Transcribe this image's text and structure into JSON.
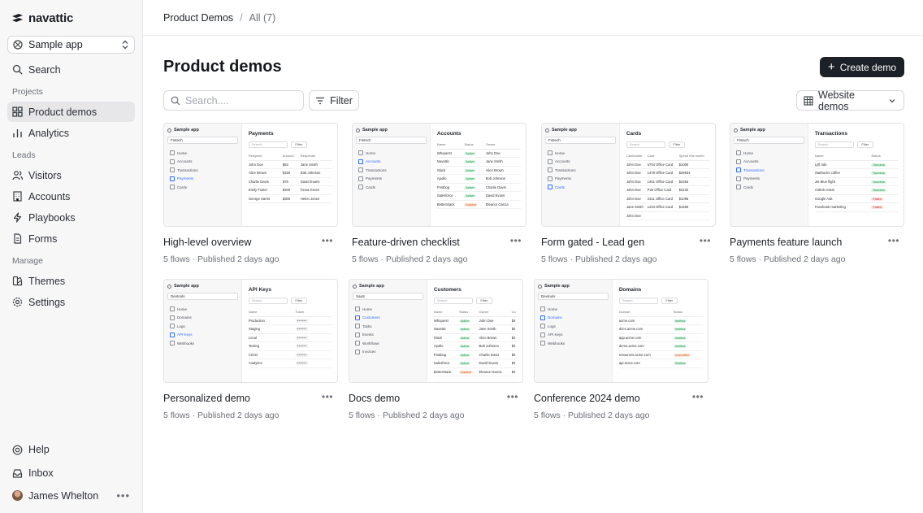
{
  "brand": {
    "name": "navattic"
  },
  "sidebar": {
    "app_select": "Sample app",
    "search": "Search",
    "sections": {
      "projects": "Projects",
      "leads": "Leads",
      "manage": "Manage"
    },
    "projects": [
      {
        "label": "Product demos",
        "icon": "grid-icon",
        "active": true
      },
      {
        "label": "Analytics",
        "icon": "bar-chart-icon",
        "active": false
      }
    ],
    "leads": [
      {
        "label": "Visitors",
        "icon": "users-icon"
      },
      {
        "label": "Accounts",
        "icon": "building-icon"
      },
      {
        "label": "Playbooks",
        "icon": "lightning-icon"
      },
      {
        "label": "Forms",
        "icon": "document-icon"
      }
    ],
    "manage": [
      {
        "label": "Themes",
        "icon": "palette-icon"
      },
      {
        "label": "Settings",
        "icon": "gear-icon"
      }
    ],
    "bottom": {
      "help": "Help",
      "inbox": "Inbox",
      "user": "James Whelton",
      "more": "•••"
    }
  },
  "breadcrumb": {
    "parent": "Product Demos",
    "separator": "/",
    "current": "All (7)"
  },
  "main": {
    "title": "Product demos",
    "create_button": "Create demo",
    "search_placeholder": "Search....",
    "filter_button": "Filter",
    "view_select": "Website demos"
  },
  "demos": [
    {
      "title": "High-level overview",
      "subtitle": "5 flows · Published 2 days ago",
      "more": "•••",
      "thumb": {
        "app": "Sample app",
        "select": "Fintech",
        "nav": [
          "Home",
          "Accounts",
          "Transactions",
          "Payments",
          "Cards"
        ],
        "active_nav": 3,
        "heading": "Payments",
        "search": "Search",
        "filter": "Filter",
        "columns": [
          "Recipient",
          "Amount",
          "Requester"
        ],
        "rows": [
          [
            "John Doe",
            "$53",
            "Jane Smith"
          ],
          [
            "Alice Brown",
            "$150",
            "Bob Johnson"
          ],
          [
            "Charlie Davis",
            "$75",
            "David Evans"
          ],
          [
            "Emily Foster",
            "$200",
            "Fiona Green"
          ],
          [
            "George Harris",
            "$300",
            "Helen Jones"
          ]
        ]
      }
    },
    {
      "title": "Feature-driven checklist",
      "subtitle": "5 flows · Published 2 days ago",
      "more": "•••",
      "thumb": {
        "app": "Sample app",
        "select": "Fintech",
        "nav": [
          "Home",
          "Accounts",
          "Transactions",
          "Payments",
          "Cards"
        ],
        "active_nav": 1,
        "heading": "Accounts",
        "search": "",
        "filter": "",
        "columns": [
          "Name",
          "Status",
          "Owner"
        ],
        "rows": [
          [
            "Whoperst",
            "Active",
            "John Doe"
          ],
          [
            "Navattic",
            "Active",
            "Jane Smith"
          ],
          [
            "Slack",
            "Active",
            "Alice Brown"
          ],
          [
            "Apollo",
            "Active",
            "Bob Johnson"
          ],
          [
            "Postbog",
            "Active",
            "Charlie Davis"
          ],
          [
            "Salesforce",
            "Active",
            "David Evans"
          ],
          [
            "BetterStack",
            "Inactive",
            "Eleanor Garcia"
          ]
        ]
      }
    },
    {
      "title": "Form gated - Lead gen",
      "subtitle": "5 flows · Published 2 days ago",
      "more": "•••",
      "thumb": {
        "app": "Sample app",
        "select": "Fintech",
        "nav": [
          "Home",
          "Accounts",
          "Transactions",
          "Payments",
          "Cards"
        ],
        "active_nav": 4,
        "heading": "Cards",
        "search": "Search",
        "filter": "Filter",
        "columns": [
          "Cardholder",
          "Card",
          "Spend this month"
        ],
        "rows": [
          [
            "John Doe",
            "5704 Office Card",
            "$1000"
          ],
          [
            "John Doe",
            "1478 Office Card",
            "$28634"
          ],
          [
            "John Doe",
            "1401 Office Card",
            "$2353"
          ],
          [
            "John Doe",
            "P25 Office Card",
            "$2232"
          ],
          [
            "John Doe",
            "2411 Office Card",
            "$1096"
          ],
          [
            "Jane Smith",
            "1234 Office Card",
            "$1560"
          ],
          [
            "John Doe",
            "",
            ""
          ]
        ]
      }
    },
    {
      "title": "Payments feature launch",
      "subtitle": "5 flows · Published 2 days ago",
      "more": "•••",
      "thumb": {
        "app": "Sample app",
        "select": "Fintech",
        "nav": [
          "Home",
          "Accounts",
          "Transactions",
          "Payments",
          "Cards"
        ],
        "active_nav": 2,
        "heading": "Transactions",
        "search": "Search",
        "filter": "Filter",
        "columns": [
          "Name",
          "Status"
        ],
        "rows": [
          [
            "Lyft ride",
            "Success"
          ],
          [
            "Starbucks coffee",
            "Success"
          ],
          [
            "Jet Blue flight",
            "Success"
          ],
          [
            "Airbnb rental",
            "Success"
          ],
          [
            "Google Ads",
            "Failed"
          ],
          [
            "Facebook marketing",
            "Failed"
          ]
        ]
      }
    },
    {
      "title": "Personalized demo",
      "subtitle": "5 flows · Published 2 days ago",
      "more": "•••",
      "thumb": {
        "app": "Sample app",
        "select": "Devtools",
        "nav": [
          "Home",
          "Domains",
          "Logs",
          "API Keys",
          "Webhooks"
        ],
        "active_nav": 3,
        "heading": "API Keys",
        "search": "Search",
        "filter": "Filter",
        "columns": [
          "Name",
          "Token"
        ],
        "rows": [
          [
            "Production",
            "••••••"
          ],
          [
            "Staging",
            "••••••"
          ],
          [
            "Local",
            "••••••"
          ],
          [
            "Testing",
            "••••••"
          ],
          [
            "CI/CD",
            "••••••"
          ],
          [
            "Analytics",
            "••••••"
          ]
        ]
      }
    },
    {
      "title": "Docs demo",
      "subtitle": "5 flows · Published 2 days ago",
      "more": "•••",
      "thumb": {
        "app": "Sample app",
        "select": "SaaS",
        "nav": [
          "Home",
          "Customers",
          "Tasks",
          "Events",
          "Workflows",
          "Invoices"
        ],
        "active_nav": 1,
        "heading": "Customers",
        "search": "Search",
        "filter": "Filter",
        "columns": [
          "Name",
          "Status",
          "Owner",
          "Co"
        ],
        "rows": [
          [
            "Whoperst",
            "Active",
            "John Doe",
            "$0"
          ],
          [
            "Navattic",
            "Active",
            "Jane Smith",
            "$0"
          ],
          [
            "Slack",
            "Active",
            "Alice Brown",
            "$0"
          ],
          [
            "Apollo",
            "Active",
            "Bob Johnson",
            "$0"
          ],
          [
            "Postbog",
            "Active",
            "Charlie Davis",
            "$0"
          ],
          [
            "Salesforce",
            "Active",
            "David Evans",
            "$0"
          ],
          [
            "BetterStack",
            "Inactive",
            "Eleanor Garcia",
            "$0"
          ]
        ]
      }
    },
    {
      "title": "Conference 2024 demo",
      "subtitle": "5 flows · Published 2 days ago",
      "more": "•••",
      "thumb": {
        "app": "Sample app",
        "select": "Devtools",
        "nav": [
          "Home",
          "Domains",
          "Logs",
          "API Keys",
          "Webhooks"
        ],
        "active_nav": 1,
        "heading": "Domains",
        "search": "Search",
        "filter": "Filter",
        "columns": [
          "Domain",
          "Status"
        ],
        "rows": [
          [
            "acme.com",
            "Verified"
          ],
          [
            "docs.acme.com",
            "Verified"
          ],
          [
            "app.acme.com",
            "Verified"
          ],
          [
            "demo.acme.com",
            "Verified"
          ],
          [
            "resources.acme.com",
            "Unverified"
          ],
          [
            "api.acme.com",
            "Verified"
          ]
        ]
      }
    }
  ],
  "colors": {
    "accent": "#2f6bff",
    "primary_button": "#1c2127",
    "success": "#138a43",
    "warning": "#d2581b",
    "danger": "#c62b2b"
  }
}
